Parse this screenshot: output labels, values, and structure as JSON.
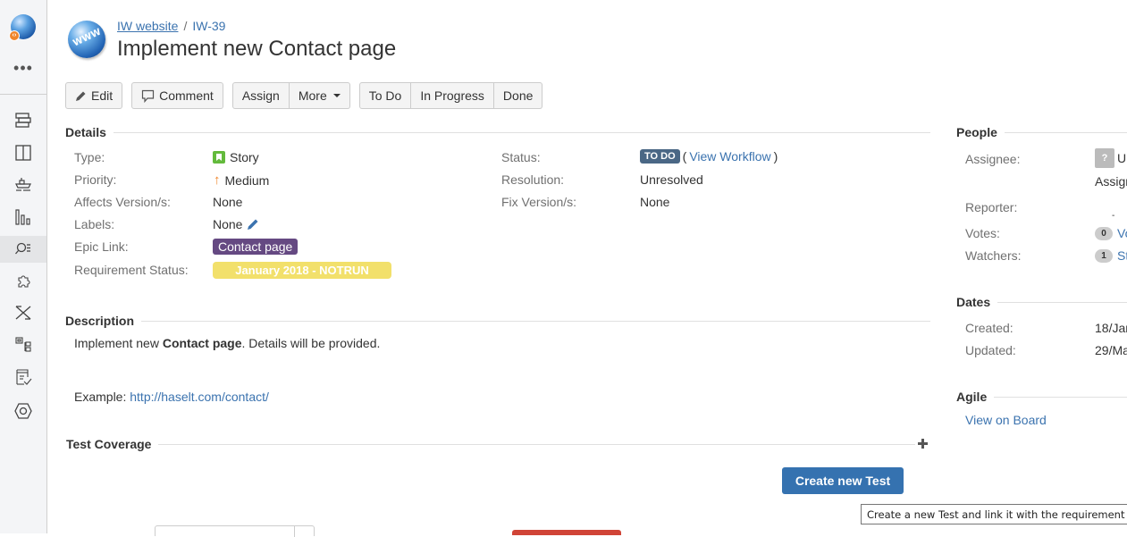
{
  "sidebar": {
    "logo_badge": "‹›",
    "more_label": "•••",
    "items": [
      {
        "name": "backlog",
        "active": false
      },
      {
        "name": "board",
        "active": false
      },
      {
        "name": "releases",
        "active": false
      },
      {
        "name": "reports",
        "active": false
      },
      {
        "name": "issues",
        "active": true
      },
      {
        "name": "add-ons",
        "active": false
      },
      {
        "name": "xray",
        "active": false
      },
      {
        "name": "test-repository",
        "active": false
      },
      {
        "name": "test-plans",
        "active": false
      },
      {
        "name": "settings",
        "active": false
      }
    ]
  },
  "header": {
    "avatar_text": "WWW",
    "project": "IW website",
    "separator": "/",
    "issue_key": "IW-39",
    "title": "Implement new Contact page"
  },
  "toolbar": {
    "edit": "Edit",
    "comment": "Comment",
    "assign": "Assign",
    "more": "More",
    "todo": "To Do",
    "in_progress": "In Progress",
    "done": "Done"
  },
  "details": {
    "heading": "Details",
    "type_label": "Type:",
    "type_value": "Story",
    "priority_label": "Priority:",
    "priority_value": "Medium",
    "affects_label": "Affects Version/s:",
    "affects_value": "None",
    "labels_label": "Labels:",
    "labels_value": "None",
    "epic_label": "Epic Link:",
    "epic_value": "Contact page",
    "req_label": "Requirement Status:",
    "req_value": "January 2018 - NOTRUN",
    "status_label": "Status:",
    "status_value": "TO DO",
    "view_workflow": "View Workflow",
    "resolution_label": "Resolution:",
    "resolution_value": "Unresolved",
    "fix_label": "Fix Version/s:",
    "fix_value": "None"
  },
  "description": {
    "heading": "Description",
    "line1_pre": "Implement new ",
    "line1_bold": "Contact page",
    "line1_post": ". Details will be provided.",
    "example_label": "Example: ",
    "example_link": "http://haselt.com/contact/"
  },
  "test_coverage": {
    "heading": "Test Coverage",
    "create_button": "Create new Test",
    "tooltip": "Create a new Test and link it with the requirement"
  },
  "people": {
    "heading": "People",
    "assignee_label": "Assignee:",
    "assignee_value": "U",
    "assign_link": "Assign",
    "reporter_label": "Reporter:",
    "reporter_value": "-",
    "votes_label": "Votes:",
    "votes_count": "0",
    "votes_link": "Vo",
    "watchers_label": "Watchers:",
    "watchers_count": "1",
    "watchers_link": "St"
  },
  "dates": {
    "heading": "Dates",
    "created_label": "Created:",
    "created_value": "18/Jan",
    "updated_label": "Updated:",
    "updated_value": "29/Ma"
  },
  "agile": {
    "heading": "Agile",
    "view_on_board": "View on Board"
  },
  "colors": {
    "link": "#3b73af",
    "epic": "#654982",
    "requirement_status": "#f2e06b",
    "status_todo": "#4a6785",
    "primary_button": "#3572b0"
  }
}
